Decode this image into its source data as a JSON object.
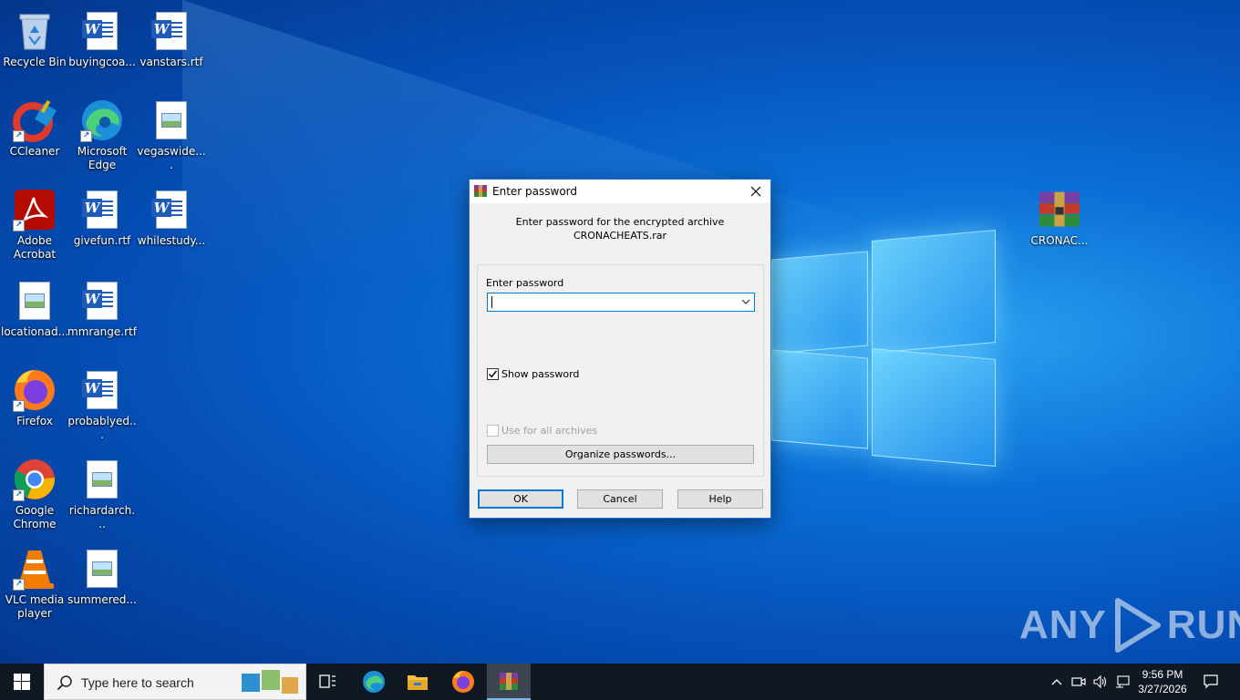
{
  "desktop": {
    "icons": [
      {
        "label": "Recycle Bin",
        "icon": "recycle-bin-icon"
      },
      {
        "label": "buyingcoa...",
        "icon": "word-document-icon"
      },
      {
        "label": "vanstars.rtf",
        "icon": "word-document-icon"
      },
      {
        "label": "CCleaner",
        "icon": "ccleaner-icon"
      },
      {
        "label": "Microsoft Edge",
        "icon": "edge-icon"
      },
      {
        "label": "vegaswide....",
        "icon": "image-file-icon"
      },
      {
        "label": "Adobe Acrobat",
        "icon": "adobe-acrobat-icon"
      },
      {
        "label": "givefun.rtf",
        "icon": "word-document-icon"
      },
      {
        "label": "whilestudy...",
        "icon": "word-document-icon"
      },
      {
        "label": "locationad...",
        "icon": "image-file-icon"
      },
      {
        "label": "mmrange.rtf",
        "icon": "word-document-icon"
      },
      {
        "label": "Firefox",
        "icon": "firefox-icon"
      },
      {
        "label": "probablyed...",
        "icon": "word-document-icon"
      },
      {
        "label": "Google Chrome",
        "icon": "chrome-icon"
      },
      {
        "label": "richardarch...",
        "icon": "image-file-icon"
      },
      {
        "label": "VLC media player",
        "icon": "vlc-icon"
      },
      {
        "label": "summered...",
        "icon": "image-file-icon"
      },
      {
        "label": "CRONAC...",
        "icon": "winrar-archive-icon"
      }
    ]
  },
  "dialog": {
    "title": "Enter password",
    "message_line1": "Enter password for the encrypted archive",
    "message_line2": "CRONACHEATS.rar",
    "password_label": "Enter password",
    "password_value": "",
    "show_password_label": "Show password",
    "show_password_checked": true,
    "use_for_all_label": "Use for all archives",
    "use_for_all_checked": false,
    "organize_button": "Organize passwords...",
    "ok_button": "OK",
    "cancel_button": "Cancel",
    "help_button": "Help"
  },
  "taskbar": {
    "search_placeholder": "Type here to search",
    "apps": [
      "task-view-icon",
      "edge-icon",
      "file-explorer-icon",
      "firefox-icon",
      "winrar-icon"
    ],
    "time": "9:56 PM",
    "date": "3/27/2026"
  },
  "watermark": {
    "text_left": "ANY",
    "text_right": "RUN"
  },
  "colors": {
    "accent": "#0078d7",
    "taskbar": "#101821"
  }
}
